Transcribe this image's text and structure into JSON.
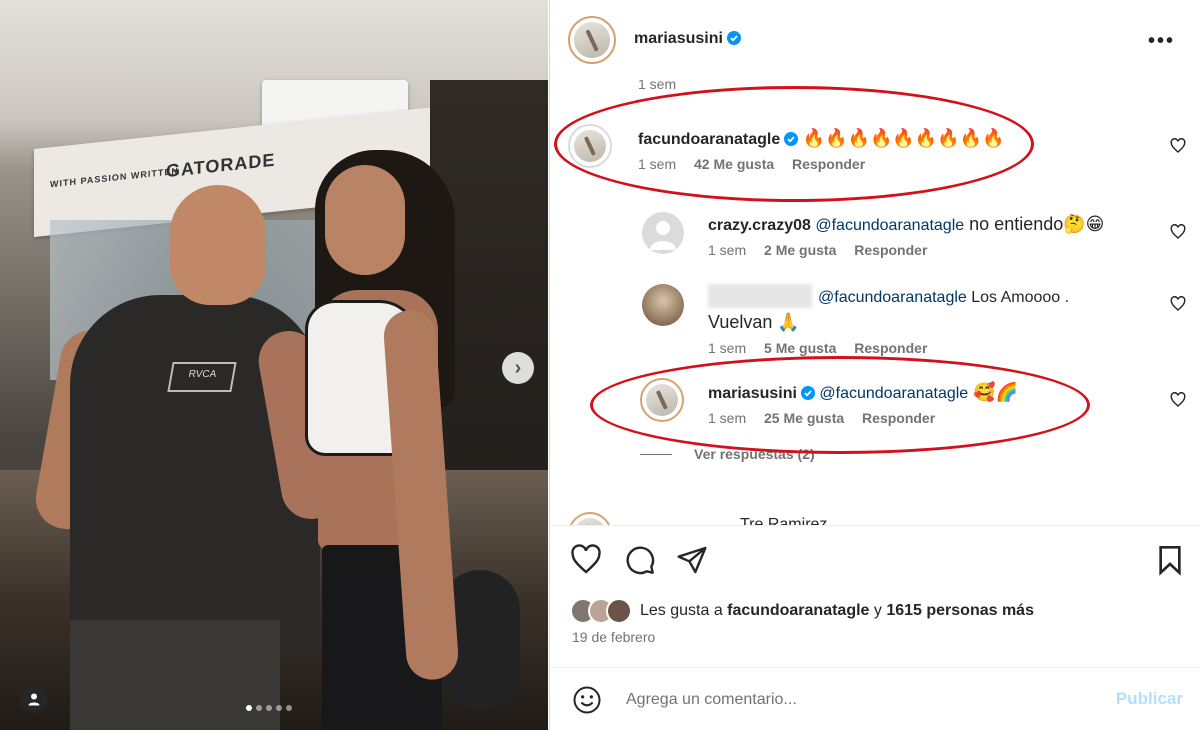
{
  "post": {
    "photo_banner_text": "GATORADE",
    "photo_banner_small": "WITH PASSION WRITTEN",
    "shirt_logo": "RVCA",
    "carousel_dots": 5,
    "carousel_active": 1
  },
  "header": {
    "username": "mariasusini",
    "verified": true
  },
  "comments": {
    "prev_time": "1 sem",
    "main": {
      "username": "facundoaranatagle",
      "text": "🔥🔥🔥🔥🔥🔥🔥🔥🔥",
      "time": "1 sem",
      "likes": "42 Me gusta",
      "reply": "Responder"
    },
    "replies": [
      {
        "username": "crazy.crazy08",
        "mention": "@facundoaranatagle",
        "text": " no entiendo🤔😁",
        "time": "1 sem",
        "likes": "2 Me gusta",
        "reply": "Responder"
      },
      {
        "username": "",
        "mention": "@facundoaranatagle",
        "text": " Los Amoooo .",
        "text2": "Vuelvan 🙏",
        "time": "1 sem",
        "likes": "5 Me gusta",
        "reply": "Responder"
      },
      {
        "username": "mariasusini",
        "mention": "@facundoaranatagle",
        "text": " 🥰🌈",
        "time": "1 sem",
        "likes": "25 Me gusta",
        "reply": "Responder"
      }
    ],
    "view_replies": "Ver respuestas (2)",
    "next_partial": "Tre Ramirez"
  },
  "actions": {
    "likes_prefix": "Les gusta a ",
    "likes_user": "facundoaranatagle",
    "likes_mid": " y ",
    "likes_count": "1615 personas más",
    "date": "19 de febrero"
  },
  "add_comment": {
    "placeholder": "Agrega un comentario...",
    "publish": "Publicar"
  },
  "colors": {
    "highlight": "#d3111b",
    "verified": "#0095f6",
    "publish_disabled": "#b2dffc",
    "mention": "#00376b"
  }
}
